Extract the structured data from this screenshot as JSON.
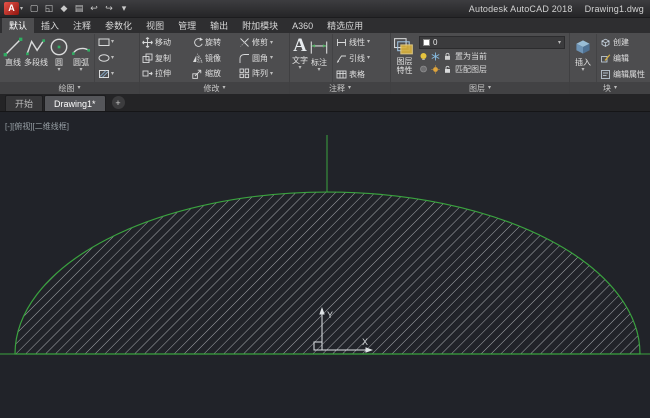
{
  "icons": {
    "chevron_down": "▾",
    "new_file": "▢",
    "open_file": "◱",
    "save_file": "◆",
    "plot": "▤",
    "undo": "↩",
    "redo": "↪"
  },
  "titlebar": {
    "logo_letter": "A",
    "title_app": "Autodesk AutoCAD 2018",
    "title_doc": "Drawing1.dwg"
  },
  "ribbon_tabs": {
    "items": [
      {
        "label": "默认",
        "active": true
      },
      {
        "label": "插入"
      },
      {
        "label": "注释"
      },
      {
        "label": "参数化"
      },
      {
        "label": "视图"
      },
      {
        "label": "管理"
      },
      {
        "label": "输出"
      },
      {
        "label": "附加模块"
      },
      {
        "label": "A360"
      },
      {
        "label": "精选应用"
      }
    ]
  },
  "draw_panel": {
    "title": "绘图",
    "line": "直线",
    "polyline": "多段线",
    "circle": "圆",
    "arc": "圆弧"
  },
  "modify_panel": {
    "title": "修改",
    "move": "移动",
    "rotate": "旋转",
    "trim": "修剪",
    "copy": "复制",
    "mirror": "镜像",
    "fillet": "圆角",
    "stretch": "拉伸",
    "scale": "缩放",
    "array": "阵列"
  },
  "annotate_panel": {
    "title": "注释",
    "text": "文字",
    "dimension": "标注",
    "linear": "线性",
    "leader": "引线",
    "table": "表格"
  },
  "layers_panel": {
    "title": "图层",
    "properties_line1": "图层",
    "properties_line2": "特性",
    "current_layer": "0",
    "set_current": "置为当前",
    "match_layer": "匹配图层"
  },
  "block_panel": {
    "title": "块",
    "insert": "插入",
    "create": "创建",
    "edit": "编辑",
    "edit_attributes": "编辑属性"
  },
  "file_tabs": {
    "start": "开始",
    "drawing": "Drawing1*",
    "new_tab": "+"
  },
  "canvas": {
    "viewport_label": "[-][俯视][二维线框]",
    "ucs_x_label": "X",
    "ucs_y_label": "Y"
  }
}
